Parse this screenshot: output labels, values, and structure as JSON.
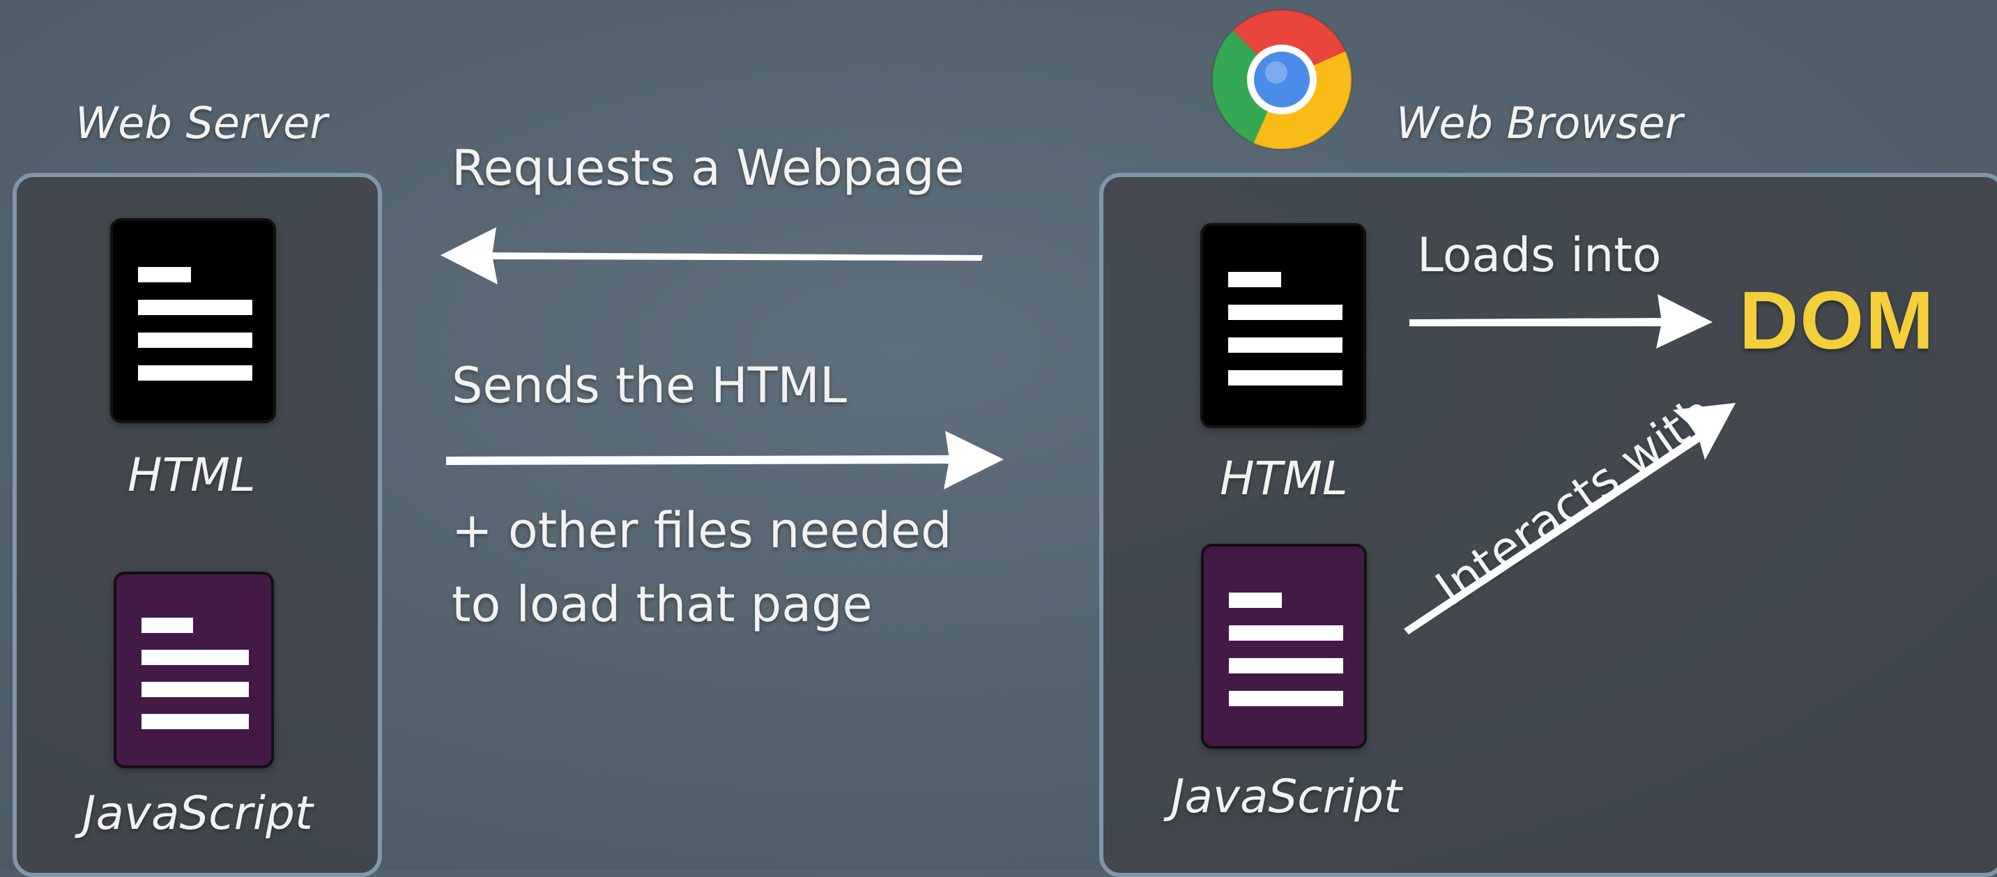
{
  "server": {
    "title": "Web Server",
    "html_label": "HTML",
    "js_label": "JavaScript"
  },
  "middle": {
    "request_label": "Requests a Webpage",
    "send_label": "Sends the HTML",
    "other_files_line1": "+ other files needed",
    "other_files_line2": "to load that page"
  },
  "browser": {
    "title": "Web Browser",
    "logo_icon": "chrome-logo-icon",
    "html_label": "HTML",
    "js_label": "JavaScript",
    "loads_into_label": "Loads into",
    "interacts_label": "Interacts with",
    "dom_label": "DOM"
  },
  "colors": {
    "panel_border": "#7f98a8",
    "dom_accent": "#f5cf3a",
    "js_file": "#431a45",
    "html_file": "#000000"
  }
}
